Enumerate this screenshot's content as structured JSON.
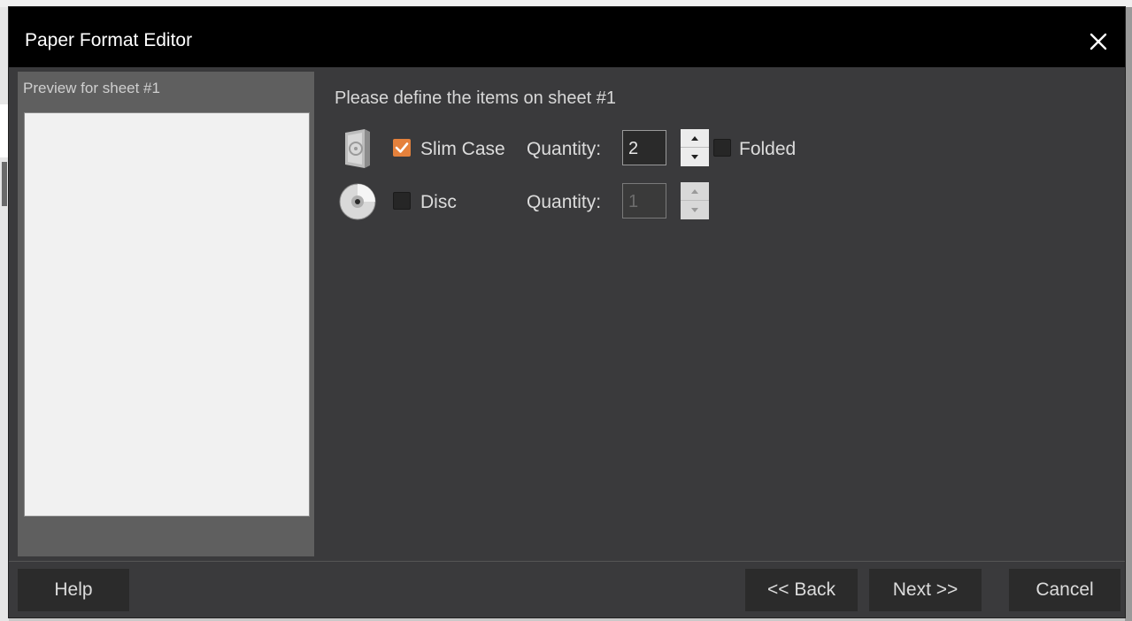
{
  "dialog": {
    "title": "Paper Format Editor"
  },
  "preview": {
    "label": "Preview for sheet #1"
  },
  "instruction": "Please define the items on sheet #1",
  "items": {
    "slim_case": {
      "label": "Slim Case",
      "checked": true,
      "quantity_label": "Quantity:",
      "quantity": "2",
      "folded_label": "Folded",
      "folded_checked": false,
      "icon": "slim-case-icon"
    },
    "disc": {
      "label": "Disc",
      "checked": false,
      "quantity_label": "Quantity:",
      "quantity": "1",
      "icon": "disc-icon"
    }
  },
  "buttons": {
    "help": "Help",
    "back": "<< Back",
    "next": "Next >>",
    "cancel": "Cancel"
  },
  "colors": {
    "accent": "#e5813c",
    "dialog_bg": "#3a3a3c",
    "titlebar_bg": "#000000"
  }
}
